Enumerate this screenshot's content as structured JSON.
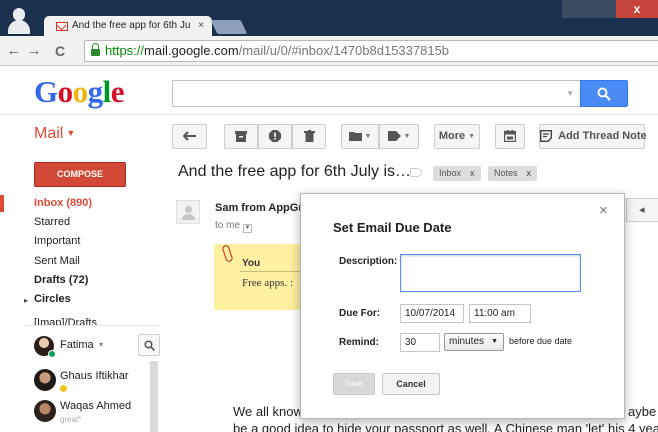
{
  "browser": {
    "tab_title": "And the free app for 6th Ju",
    "tab_close": "×",
    "close_glyph": "x",
    "url_scheme": "https://",
    "url_host": "mail.google.com",
    "url_path": "/mail/u/0/#inbox/1470b8d15337815b",
    "back_glyph": "←",
    "forward_glyph": "→",
    "reload_glyph": "C"
  },
  "header": {
    "logo_letters": [
      "G",
      "o",
      "o",
      "g",
      "l",
      "e"
    ],
    "search_value": "",
    "search_dropdown": "▼"
  },
  "mail_menu": {
    "label": "Mail",
    "caret": "▼"
  },
  "toolbar": {
    "more_label": "More",
    "add_thread_note_label": "Add Thread Note",
    "caret": "▼"
  },
  "thread": {
    "subject": "And the free app for 6th July is…",
    "labels": [
      {
        "name": "Inbox",
        "remove": "x"
      },
      {
        "name": "Notes",
        "remove": "x"
      }
    ]
  },
  "sidebar": {
    "compose_label": "COMPOSE",
    "items": [
      {
        "label": "Inbox (890)"
      },
      {
        "label": "Starred"
      },
      {
        "label": "Important"
      },
      {
        "label": "Sent Mail"
      },
      {
        "label": "Drafts (72)"
      },
      {
        "label": "Circles"
      },
      {
        "label": "[Imap]/Drafts"
      }
    ],
    "circles_arrow": "▸"
  },
  "chat": {
    "me": {
      "name": "Fatima",
      "caret": "▼"
    },
    "contacts": [
      {
        "name": "Ghaus Iftikhar",
        "status": ""
      },
      {
        "name": "Waqas Ahmed",
        "status": "great*"
      }
    ]
  },
  "message": {
    "sender": "Sam from AppGr",
    "to_me": "to me",
    "to_me_dd": "▼",
    "note_title": "You",
    "note_body": "Free apps. :",
    "body_lines": [
      "We all know",
      "be a good idea to hide your passport as well. A Chinese man 'let' his 4 yea"
    ],
    "body_right": "aybe it",
    "right_button_glyph": "◂"
  },
  "dialog": {
    "title": "Set Email Due Date",
    "close": "×",
    "description_label": "Description:",
    "description_value": "",
    "due_for_label": "Due For:",
    "due_date": "10/07/2014",
    "due_time": "11:00 am",
    "remind_label": "Remind:",
    "remind_value": "30",
    "remind_unit": "minutes",
    "remind_unit_arrow": "▼",
    "remind_suffix": "before due date",
    "save_label": "Save",
    "cancel_label": "Cancel"
  },
  "colors": {
    "chrome_frame": "#1b2f4e",
    "gmail_red": "#dd4b39",
    "compose_red": "#d14836",
    "search_blue": "#4a8af4",
    "note_yellow": "#fdf0a1",
    "online_green": "#0f9d58"
  }
}
